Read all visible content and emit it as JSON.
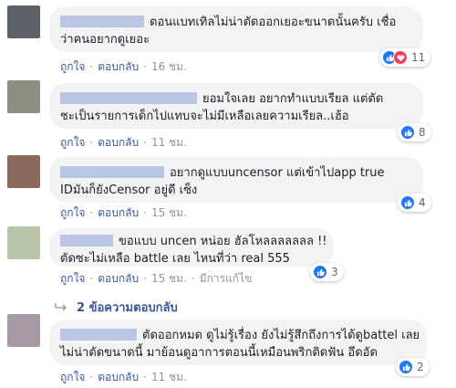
{
  "comments": [
    {
      "lines": [
        "ตอนแบทเทิลไม่น่าตัดออกเยอะขนาดนั้นครับ เชื่อ",
        "ว่าคนอยากดูเยอะ"
      ],
      "like_label": "ถูกใจ",
      "reply_label": "ตอบกลับ",
      "time": "16 ชม.",
      "reaction_count": "11",
      "reactions": [
        "like-icon",
        "love-icon"
      ],
      "avatar_color": "#5d6168"
    },
    {
      "lines": [
        "ยอมใจเลย อยากทำแบบเรียล แต่ตัด",
        "ชะเป็นรายการเด็กไปแทบจะไม่มีเหลือเลยความเรียล..เฮ้อ"
      ],
      "like_label": "ถูกใจ",
      "reply_label": "ตอบกลับ",
      "time": "11 ชม.",
      "reaction_count": "8",
      "reactions": [
        "like-icon"
      ],
      "avatar_color": "#8e8f80"
    },
    {
      "lines": [
        "อยากดูแบบuncensor แต่เข้าไปapp true",
        "IDมันก็ยังCensor อยู่ดี เซ็ง"
      ],
      "like_label": "ถูกใจ",
      "reply_label": "ตอบกลับ",
      "time": "15 ชม.",
      "reaction_count": "4",
      "reactions": [
        "like-icon"
      ],
      "avatar_color": "#8a6a5c"
    },
    {
      "lines": [
        "ขอแบบ uncen หน่อย ฮัลโหลลลลลลล !!",
        "ตัดซะไม่เหลือ battle เลย ไหนที่ว่า real 555"
      ],
      "like_label": "ถูกใจ",
      "reply_label": "ตอบกลับ",
      "time": "15 ชม.",
      "edited": "มีการแก้ไข",
      "reaction_count": "3",
      "reactions": [
        "like-icon"
      ],
      "avatar_color": "#b8c4a8"
    },
    {
      "lines": [
        "ตัดออกหมด ดูไม่รู้เรื่อง ยังไม่รู้สึกถึงการได้ดูbattel เลย",
        "ไม่น่าตัดขนาดนี้ มาย้อนดูอาการตอนนี้เหมือนพริกติดฟัน อึดอัด"
      ],
      "like_label": "ถูกใจ",
      "reply_label": "ตอบกลับ",
      "time": "11 ชม.",
      "reaction_count": "2",
      "reactions": [
        "like-icon"
      ],
      "avatar_color": "#a89aa4"
    }
  ],
  "replies_link": "2 ข้อความตอบกลับ",
  "colors": {
    "link": "#385898",
    "bubble": "#f2f3f5",
    "like": "#2078f4",
    "love": "#f33e58",
    "meta": "#90949c"
  }
}
